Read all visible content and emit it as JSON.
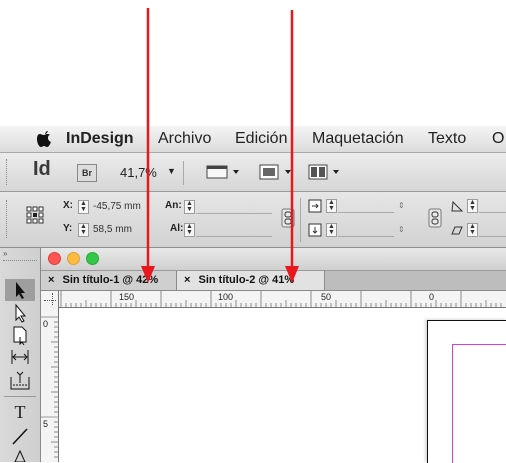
{
  "menubar": {
    "apple_icon": "apple-logo-icon",
    "items": [
      "InDesign",
      "Archivo",
      "Edición",
      "Maquetación",
      "Texto",
      "O"
    ]
  },
  "appbar": {
    "logo": "Id",
    "bridge": "Br",
    "zoom": "41,7%"
  },
  "control_panel": {
    "x_label": "X:",
    "x_value": "-45,75 mm",
    "y_label": "Y:",
    "y_value": "58,5 mm",
    "w_label": "An:",
    "h_label": "Al:"
  },
  "document": {
    "tabs": [
      {
        "label": "Sin título-1 @ 42%",
        "close": "×"
      },
      {
        "label": "Sin título-2 @ 41%",
        "close": "×"
      }
    ],
    "hruler_labels": [
      "150",
      "100",
      "50",
      "0"
    ],
    "vruler_labels": [
      "0",
      "5"
    ]
  },
  "colors": {
    "arrow": "#e8171b",
    "traffic_red": "#fc5753",
    "traffic_yellow": "#fdbc40",
    "traffic_green": "#33c748",
    "margin_guide": "#d43fd4"
  }
}
